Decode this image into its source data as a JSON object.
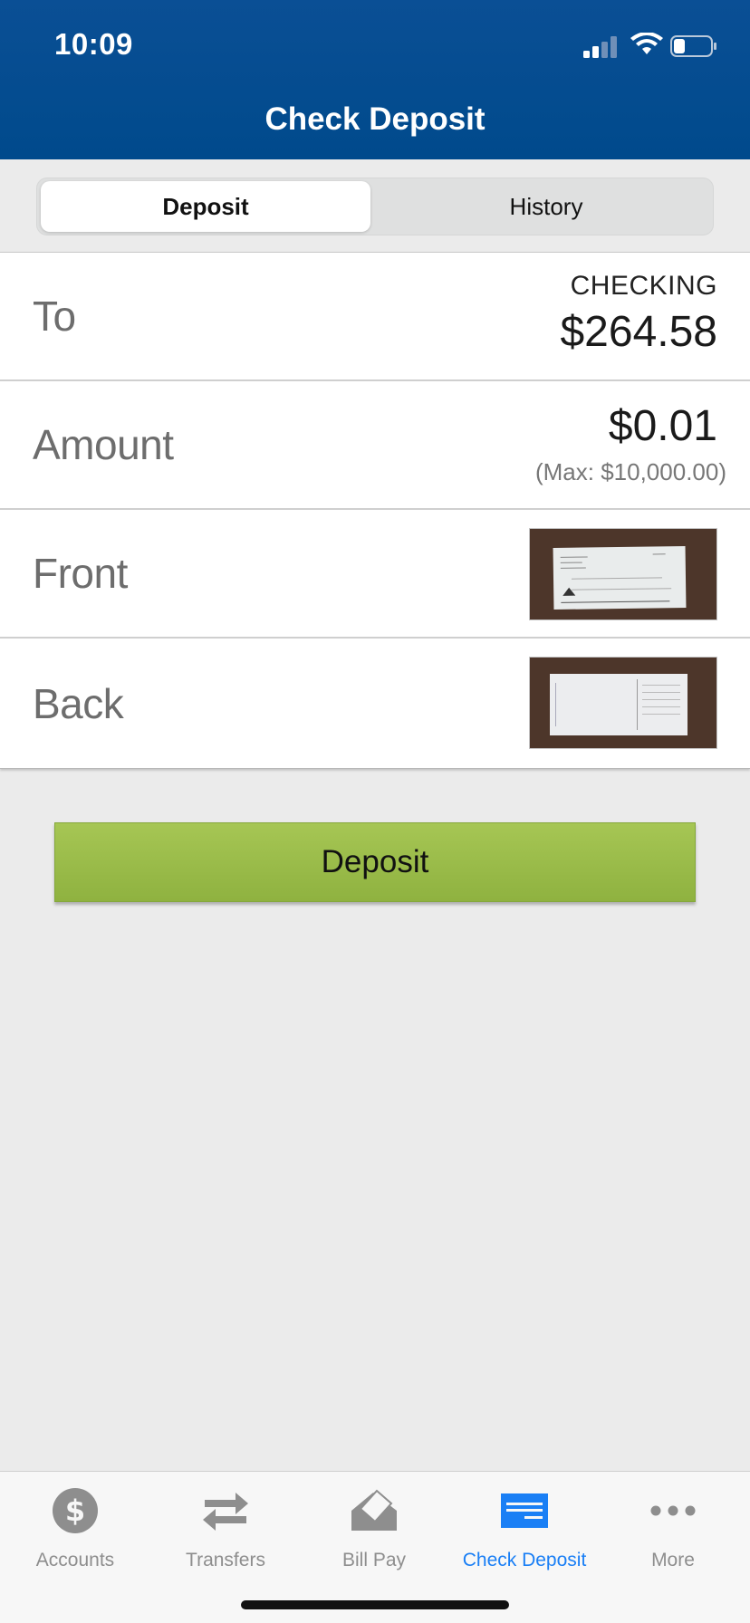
{
  "status_bar": {
    "time": "10:09"
  },
  "header": {
    "title": "Check Deposit"
  },
  "segment": {
    "deposit_label": "Deposit",
    "history_label": "History"
  },
  "form": {
    "to_label": "To",
    "account_name": "CHECKING",
    "account_balance": "$264.58",
    "amount_label": "Amount",
    "amount_value": "$0.01",
    "amount_max": "(Max: $10,000.00)",
    "front_label": "Front",
    "back_label": "Back"
  },
  "deposit_button": {
    "label": "Deposit",
    "color": "#9bbd4a"
  },
  "tabbar": {
    "items": [
      {
        "label": "Accounts",
        "icon": "dollar-circle-icon"
      },
      {
        "label": "Transfers",
        "icon": "transfer-arrows-icon"
      },
      {
        "label": "Bill Pay",
        "icon": "bill-pay-icon"
      },
      {
        "label": "Check Deposit",
        "icon": "check-deposit-icon",
        "active": true
      },
      {
        "label": "More",
        "icon": "more-dots-icon"
      }
    ],
    "active_color": "#1a7ff5"
  },
  "colors": {
    "header": "#004a8c",
    "background": "#ebebeb"
  }
}
